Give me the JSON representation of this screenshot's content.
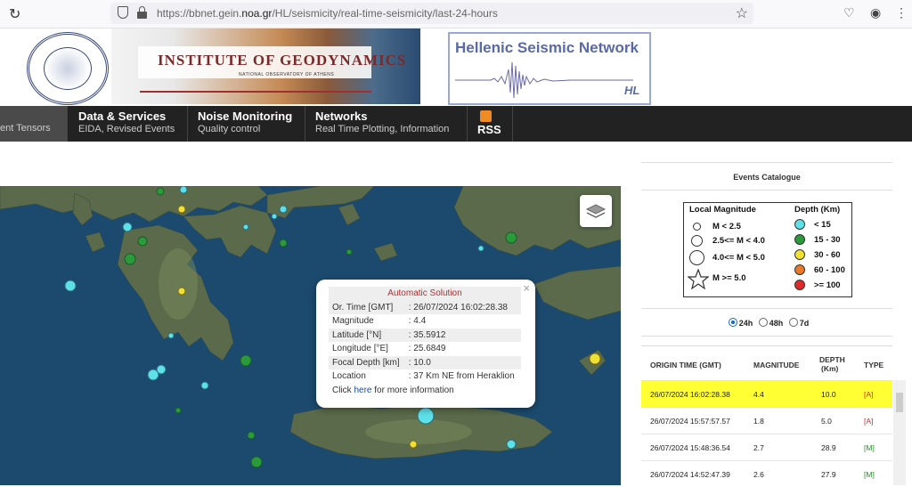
{
  "browser": {
    "url_prefix": "https://bbnet.gein.",
    "url_domain": "noa.gr",
    "url_path": "/HL/seismicity/real-time-seismicity/last-24-hours"
  },
  "header": {
    "institute_title": "INSTITUTE OF GEODYNAMICS",
    "institute_subtitle": "NATIONAL OBSERVATORY OF ATHENS",
    "network_title": "Hellenic Seismic Network",
    "network_code": "HL"
  },
  "nav": [
    {
      "title": "",
      "subtitle": "ent Tensors"
    },
    {
      "title": "Data & Services",
      "subtitle": "EIDA, Revised Events"
    },
    {
      "title": "Noise Monitoring",
      "subtitle": "Quality control"
    },
    {
      "title": "Networks",
      "subtitle": "Real Time Plotting, Information"
    },
    {
      "title": "",
      "subtitle": "RSS"
    }
  ],
  "popup": {
    "title": "Automatic Solution",
    "close": "×",
    "rows": [
      {
        "label": "Or. Time [GMT]",
        "value": ": 26/07/2024 16:02:28.38"
      },
      {
        "label": "Magnitude",
        "value": ": 4.4"
      },
      {
        "label": "Latitude [°N]",
        "value": ": 35.5912"
      },
      {
        "label": "Longitude [°E]",
        "value": ": 25.6849"
      },
      {
        "label": "Focal Depth [km]",
        "value": ": 10.0"
      },
      {
        "label": "Location",
        "value": ": 37 Km NE from Heraklion"
      }
    ],
    "footer_pre": "Click ",
    "footer_link": "here",
    "footer_post": " for more information"
  },
  "sidebar": {
    "catalogue_title": "Events Catalogue",
    "legend": {
      "mag_header": "Local Magnitude",
      "depth_header": "Depth (Km)",
      "mag_rows": [
        "M < 2.5",
        "2.5<= M < 4.0",
        "4.0<= M < 5.0",
        "M >= 5.0"
      ],
      "depth_rows": [
        {
          "label": "< 15",
          "color": "#5ee0e8"
        },
        {
          "label": "15 - 30",
          "color": "#2a9a3a"
        },
        {
          "label": "30 - 60",
          "color": "#f0e030"
        },
        {
          "label": "60 - 100",
          "color": "#e87a2a"
        },
        {
          "label": ">= 100",
          "color": "#e02a2a"
        }
      ]
    },
    "periods": [
      "24h",
      "48h",
      "7d"
    ],
    "table": {
      "headers": {
        "time": "ORIGIN TIME (GMT)",
        "mag": "MAGNITUDE",
        "depth_1": "DEPTH",
        "depth_2": "(Km)",
        "type": "TYPE"
      },
      "rows": [
        {
          "time": "26/07/2024 16:02:28.38",
          "mag": "4.4",
          "depth": "10.0",
          "type": "[A]"
        },
        {
          "time": "26/07/2024 15:57:57.57",
          "mag": "1.8",
          "depth": "5.0",
          "type": "[A]"
        },
        {
          "time": "26/07/2024 15:48:36.54",
          "mag": "2.7",
          "depth": "28.9",
          "type": "[M]"
        },
        {
          "time": "26/07/2024 14:52:47.39",
          "mag": "2.6",
          "depth": "27.9",
          "type": "[M]"
        }
      ]
    }
  }
}
